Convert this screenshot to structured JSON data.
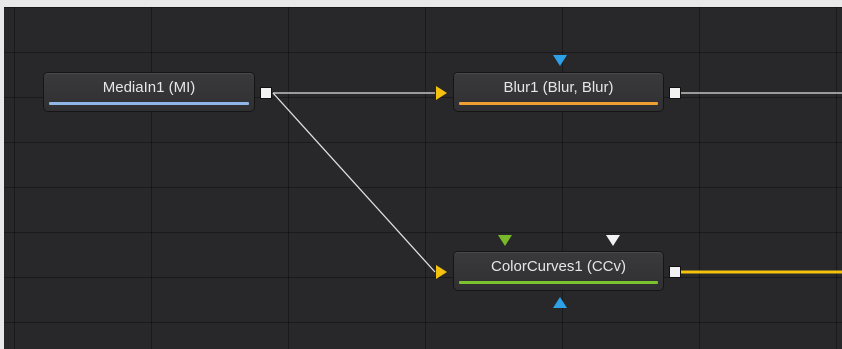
{
  "nodes": {
    "mediain": {
      "label": "MediaIn1  (MI)",
      "bar_color": "#8fb6e6"
    },
    "blur": {
      "label": "Blur1  (Blur, Blur)",
      "bar_color": "#f0a030"
    },
    "colorcurves": {
      "label": "ColorCurves1  (CCv)",
      "bar_color": "#7cc22e"
    }
  },
  "colors": {
    "canvas_bg": "#28282b",
    "wire_default": "#e0e0e0",
    "wire_active": "#f4c20d",
    "input_main": "#f4c20d",
    "input_mask": "#2ea0e6",
    "input_effect_mask": "#2ea0e6",
    "input_fg": "#78b82a",
    "input_white": "#f2f2f2"
  },
  "icons": {
    "main_input": "triangle-right",
    "mask_input": "triangle-down",
    "output_port": "square"
  }
}
